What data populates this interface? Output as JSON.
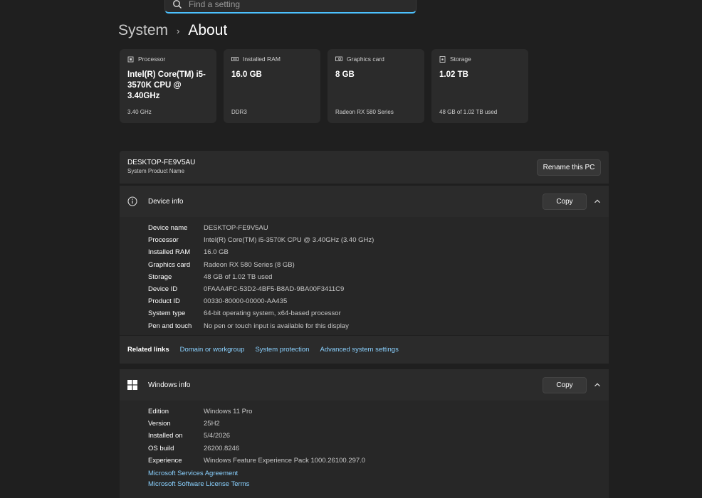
{
  "search": {
    "placeholder": "Find a setting"
  },
  "breadcrumb": {
    "parent": "System",
    "separator": "›",
    "current": "About"
  },
  "cards": [
    {
      "icon": "processor-icon",
      "label": "Processor",
      "value": "Intel(R) Core(TM) i5-3570K CPU @ 3.40GHz",
      "sub": "3.40 GHz"
    },
    {
      "icon": "ram-icon",
      "label": "Installed RAM",
      "value": "16.0 GB",
      "sub": "DDR3"
    },
    {
      "icon": "graphics-card-icon",
      "label": "Graphics card",
      "value": "8 GB",
      "sub": "Radeon RX 580 Series"
    },
    {
      "icon": "storage-icon",
      "label": "Storage",
      "value": "1.02 TB",
      "sub": "48 GB of 1.02 TB used"
    }
  ],
  "pc": {
    "name": "DESKTOP-FE9V5AU",
    "sub": "System Product Name",
    "rename_label": "Rename this PC"
  },
  "device_info": {
    "title": "Device info",
    "copy_label": "Copy",
    "rows": [
      {
        "k": "Device name",
        "v": "DESKTOP-FE9V5AU"
      },
      {
        "k": "Processor",
        "v": "Intel(R) Core(TM) i5-3570K CPU @ 3.40GHz (3.40 GHz)"
      },
      {
        "k": "Installed RAM",
        "v": "16.0 GB"
      },
      {
        "k": "Graphics card",
        "v": "Radeon RX 580 Series (8 GB)"
      },
      {
        "k": "Storage",
        "v": "48 GB of 1.02 TB used"
      },
      {
        "k": "Device ID",
        "v": "0FAAA4FC-53D2-4BF5-B8AD-9BA00F3411C9"
      },
      {
        "k": "Product ID",
        "v": "00330-80000-00000-AA435"
      },
      {
        "k": "System type",
        "v": "64-bit operating system, x64-based processor"
      },
      {
        "k": "Pen and touch",
        "v": "No pen or touch input is available for this display"
      }
    ]
  },
  "related": {
    "label": "Related links",
    "links": [
      "Domain or workgroup",
      "System protection",
      "Advanced system settings"
    ]
  },
  "windows_info": {
    "title": "Windows info",
    "copy_label": "Copy",
    "rows": [
      {
        "k": "Edition",
        "v": "Windows 11 Pro"
      },
      {
        "k": "Version",
        "v": "25H2"
      },
      {
        "k": "Installed on",
        "v": "5/4/2026"
      },
      {
        "k": "OS build",
        "v": "26200.8246"
      },
      {
        "k": "Experience",
        "v": "Windows Feature Experience Pack 1000.26100.297.0"
      }
    ],
    "links": [
      "Microsoft Services Agreement",
      "Microsoft Software License Terms"
    ]
  },
  "colors": {
    "background": "#1f1f1f",
    "card": "#2b2b2b",
    "link": "#8ad1ff",
    "accent": "#4cc2ff"
  }
}
